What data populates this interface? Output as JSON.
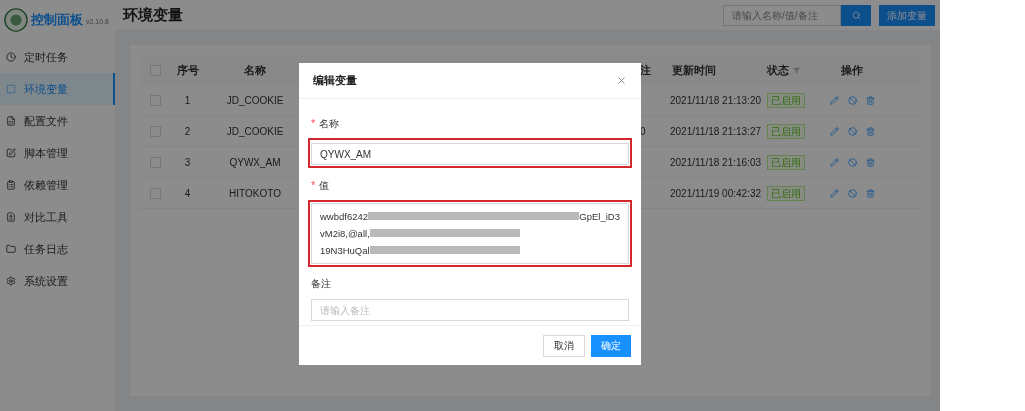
{
  "app": {
    "title": "控制面板",
    "version": "v2.10.8"
  },
  "sidebar": {
    "items": [
      {
        "label": "定时任务",
        "selected": false
      },
      {
        "label": "环境变量",
        "selected": true
      },
      {
        "label": "配置文件",
        "selected": false
      },
      {
        "label": "脚本管理",
        "selected": false
      },
      {
        "label": "依赖管理",
        "selected": false
      },
      {
        "label": "对比工具",
        "selected": false
      },
      {
        "label": "任务日志",
        "selected": false
      },
      {
        "label": "系统设置",
        "selected": false
      }
    ]
  },
  "header": {
    "title": "环境变量",
    "search": {
      "placeholder": "请输入名称/值/备注"
    },
    "add_button": "添加变量"
  },
  "table": {
    "select_all_checked": false,
    "columns": {
      "index": "序号",
      "name": "名称",
      "column_4": "注",
      "updated": "更新时间",
      "status": "状态",
      "actions": "操作"
    },
    "rows": [
      {
        "checked": false,
        "index": "1",
        "name": "JD_COOKIE",
        "updated": "2021/11/18 21:13:20",
        "status": "已启用"
      },
      {
        "checked": false,
        "index": "2",
        "name": "JD_COOKIE",
        "column_4": "0",
        "updated": "2021/11/18 21:13:27",
        "status": "已启用"
      },
      {
        "checked": false,
        "index": "3",
        "name": "QYWX_AM",
        "updated": "2021/11/18 21:16:03",
        "status": "已启用"
      },
      {
        "checked": false,
        "index": "4",
        "name": "HITOKOTO",
        "updated": "2021/11/19 00:42:32",
        "status": "已启用"
      }
    ]
  },
  "dialog": {
    "title": "编辑变量",
    "fields": [
      {
        "kind": "input",
        "required_mark": "*",
        "label": "名称",
        "highlighted": true,
        "value": "QYWX_AM"
      },
      {
        "kind": "textarea",
        "required_mark": "*",
        "label": "值",
        "highlighted": true,
        "value_lines": [
          [
            {
              "kind": "text",
              "text": "wwbdf6242"
            },
            {
              "kind": "redacted"
            },
            {
              "kind": "text",
              "text": "GpEl_iD3"
            }
          ],
          [
            {
              "kind": "text",
              "text": "vM2i8,@all,"
            },
            {
              "kind": "redacted"
            }
          ],
          [
            {
              "kind": "text",
              "text": "19N3HuQal"
            },
            {
              "kind": "redacted"
            }
          ]
        ]
      },
      {
        "kind": "input",
        "label": "备注",
        "highlighted": false,
        "placeholder": "请输入备注"
      }
    ],
    "buttons": [
      {
        "label": "取消",
        "primary": false
      },
      {
        "label": "确定",
        "primary": true
      }
    ]
  }
}
